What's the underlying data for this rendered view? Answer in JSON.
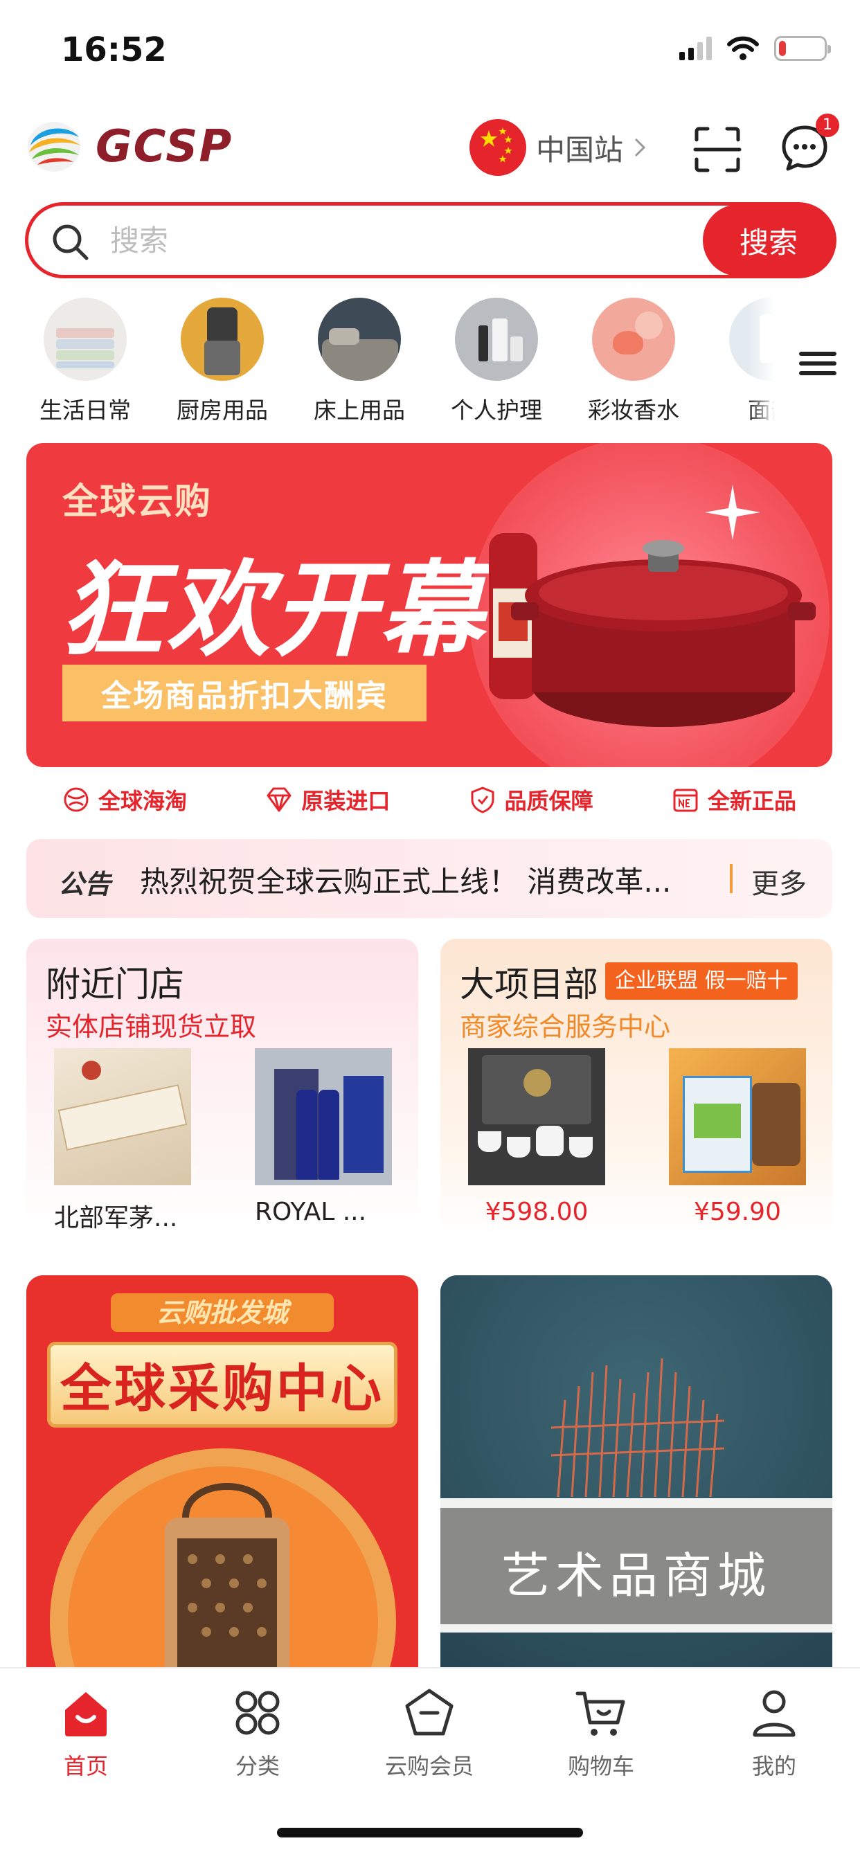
{
  "status_bar": {
    "time": "16:52",
    "icons": [
      "signal-icon",
      "wifi-icon",
      "battery-low-icon"
    ],
    "battery_level": 0.15
  },
  "header": {
    "logo_text": "GCSP",
    "site_label": "中国站",
    "message_badge": "1",
    "icons": [
      "scan-icon",
      "message-icon",
      "chevron-right-icon"
    ]
  },
  "search": {
    "placeholder": "搜索",
    "button_label": "搜索"
  },
  "categories": [
    {
      "label": "生活日常",
      "icon": "towels-image"
    },
    {
      "label": "厨房用品",
      "icon": "juicer-image"
    },
    {
      "label": "床上用品",
      "icon": "bedding-image"
    },
    {
      "label": "个人护理",
      "icon": "skincare-image"
    },
    {
      "label": "彩妆香水",
      "icon": "cosmetics-image"
    },
    {
      "label": "面部",
      "icon": "facial-image"
    }
  ],
  "banner": {
    "subtitle": "全球云购",
    "title": "狂欢开幕",
    "tag": "全场商品折扣大酬宾"
  },
  "features": [
    {
      "label": "全球海淘",
      "icon": "globe-icon"
    },
    {
      "label": "原装进口",
      "icon": "diamond-icon"
    },
    {
      "label": "品质保障",
      "icon": "shield-icon"
    },
    {
      "label": "全新正品",
      "icon": "new-tag-icon"
    }
  ],
  "notice": {
    "badge": "公告",
    "text": "热烈祝贺全球云购正式上线！ 消费改革...",
    "more": "更多"
  },
  "nearby_store": {
    "title": "附近门店",
    "subtitle": "实体店铺现货立取",
    "products": [
      {
        "label": "北部军茅..."
      },
      {
        "label": "ROYAL ..."
      }
    ]
  },
  "major_projects": {
    "title": "大项目部",
    "badge": "企业联盟 假一赔十",
    "subtitle": "商家综合服务中心",
    "products": [
      {
        "price": "¥598.00"
      },
      {
        "price": "¥59.90"
      }
    ]
  },
  "promos": {
    "left_ribbon": "云购批发城",
    "left_title": "全球采购中心",
    "right_title": "艺术品商城"
  },
  "tabbar": [
    {
      "label": "首页",
      "icon": "home-icon",
      "active": true
    },
    {
      "label": "分类",
      "icon": "grid-icon",
      "active": false
    },
    {
      "label": "云购会员",
      "icon": "member-icon",
      "active": false
    },
    {
      "label": "购物车",
      "icon": "cart-icon",
      "active": false
    },
    {
      "label": "我的",
      "icon": "user-icon",
      "active": false
    }
  ],
  "colors": {
    "accent": "#e5242b",
    "orange": "#f4631d",
    "logo": "#8e1e2a"
  }
}
